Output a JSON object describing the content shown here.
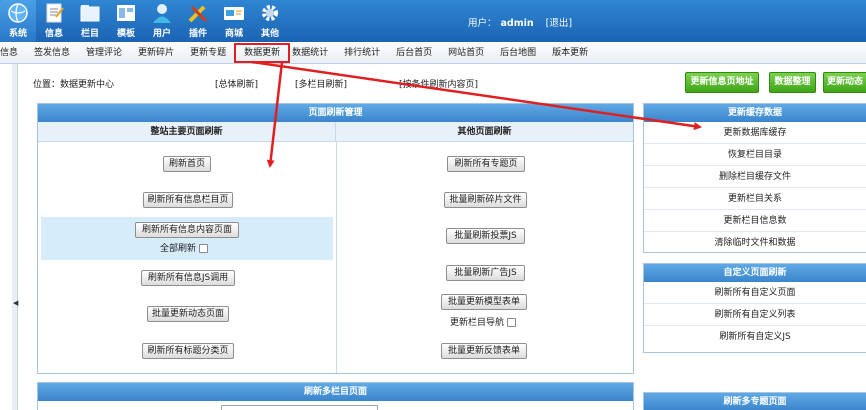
{
  "topnav": [
    {
      "label": "系统",
      "icon": "globe-icon",
      "active": true
    },
    {
      "label": "信息",
      "icon": "document-icon"
    },
    {
      "label": "栏目",
      "icon": "folder-icon"
    },
    {
      "label": "模板",
      "icon": "template-icon"
    },
    {
      "label": "用户",
      "icon": "user-icon"
    },
    {
      "label": "插件",
      "icon": "tools-icon"
    },
    {
      "label": "商城",
      "icon": "shop-card-icon"
    },
    {
      "label": "其他",
      "icon": "gear-icon"
    }
  ],
  "user": {
    "prefix": "用户：",
    "name": "admin",
    "logout": "[退出]"
  },
  "submenu": [
    "信息",
    "签发信息",
    "管理评论",
    "更新碎片",
    "更新专题",
    "数据更新",
    "数据统计",
    "排行统计",
    "后台首页",
    "网站首页",
    "后台地图",
    "版本更新"
  ],
  "location": "位置：数据更新中心",
  "links": {
    "all": "[总体刷新]",
    "multi": "[多栏目刷新]",
    "cond": "[按条件刷新内容页]"
  },
  "green_buttons": [
    "更新信息页地址",
    "数据整理",
    "更新动态"
  ],
  "main_panel": {
    "title": "页面刷新管理",
    "left_head": "整站主要页面刷新",
    "right_head": "其他页面刷新",
    "left_buttons": [
      "刷新首页",
      "刷新所有信息栏目页",
      "刷新所有信息内容页面",
      "刷新所有信息JS调用",
      "批量更新动态页面",
      "刷新所有标题分类页"
    ],
    "all_refresh": "全部刷新",
    "right_buttons": [
      "刷新所有专题页",
      "批量刷新碎片文件",
      "批量刷新投票JS",
      "批量刷新广告JS",
      "批量更新模型表单",
      "批量更新反馈表单"
    ],
    "nav_refresh": "更新栏目导航"
  },
  "cache_panel": {
    "title": "更新缓存数据",
    "items": [
      "更新数据库缓存",
      "恢复栏目目录",
      "删除栏目缓存文件",
      "更新栏目关系",
      "更新栏目信息数",
      "清除临时文件和数据"
    ]
  },
  "custom_panel": {
    "title": "自定义页面刷新",
    "items": [
      "刷新所有自定义页面",
      "刷新所有自定义列表",
      "刷新所有自定义JS"
    ]
  },
  "multi_panel": {
    "title": "刷新多栏目页面"
  },
  "topic_panel": {
    "title": "刷新多专题页面"
  },
  "colors": {
    "accent": "#2f86d3",
    "green": "#3fa418",
    "annotation": "#e02020"
  }
}
